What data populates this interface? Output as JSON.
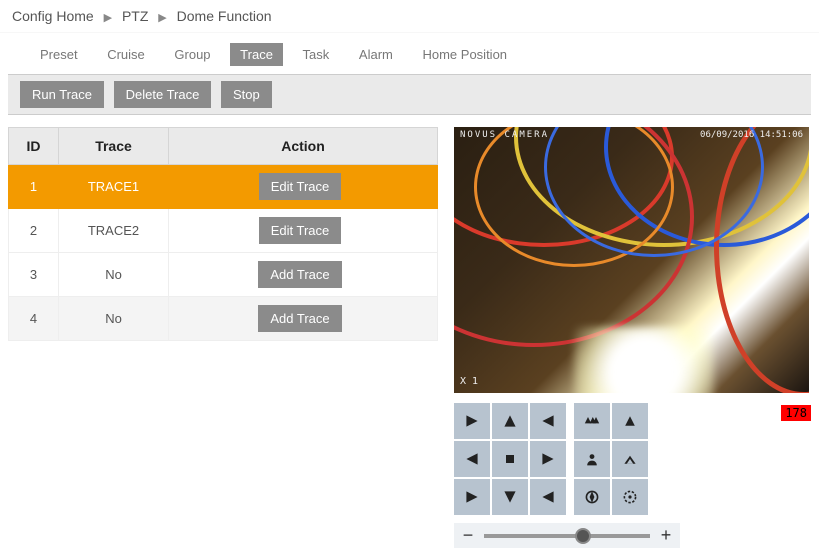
{
  "breadcrumb": {
    "home": "Config Home",
    "mid": "PTZ",
    "leaf": "Dome Function"
  },
  "tabs": {
    "preset": "Preset",
    "cruise": "Cruise",
    "group": "Group",
    "trace": "Trace",
    "task": "Task",
    "alarm": "Alarm",
    "home": "Home Position"
  },
  "toolbar": {
    "run": "Run Trace",
    "delete": "Delete Trace",
    "stop": "Stop"
  },
  "table": {
    "head_id": "ID",
    "head_trace": "Trace",
    "head_action": "Action",
    "rows": [
      {
        "id": "1",
        "trace": "TRACE1",
        "action": "Edit Trace"
      },
      {
        "id": "2",
        "trace": "TRACE2",
        "action": "Edit Trace"
      },
      {
        "id": "3",
        "trace": "No",
        "action": "Add Trace"
      },
      {
        "id": "4",
        "trace": "No",
        "action": "Add Trace"
      }
    ]
  },
  "osd": {
    "left": "NOVUS CAMERA",
    "right": "06/09/2016 14:51:06",
    "zoom": "X 1"
  },
  "badge": "178",
  "slider": {
    "minus": "−",
    "plus": "+"
  }
}
